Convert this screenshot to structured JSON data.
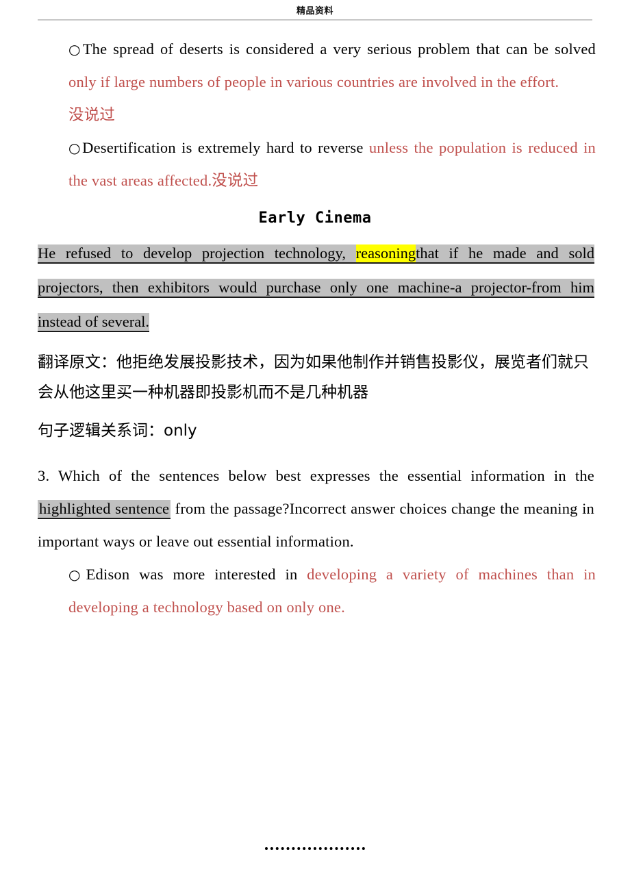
{
  "header": {
    "title": "精品资料"
  },
  "colors": {
    "red_text": "#c0504d",
    "gray_highlight": "#c0c0c0",
    "yellow_highlight": "#ffff00",
    "header_rule": "#c8c8c8"
  },
  "options_group_1": {
    "bullet_marker": "○",
    "option_a": {
      "black_part": "The spread of deserts is considered a very serious problem that can be solved ",
      "red_part": "only if large numbers of people in various countries are involved in the effort.",
      "note": "没说过"
    },
    "option_b": {
      "black_part": "Desertification is extremely hard to reverse ",
      "red_part": "unless the population is reduced in the vast areas affected.",
      "note": "没说过"
    }
  },
  "section": {
    "title": "Early Cinema"
  },
  "quote": {
    "gray_part_1": "He refused to develop projection technology, ",
    "yellow_part": "reasoning",
    "gray_part_2": "that if he made and sold projectors, then exhibitors would purchase only one machine-a projector-from him instead of several."
  },
  "translation": {
    "label_and_text": "翻译原文：他拒绝发展投影技术，因为如果他制作并销售投影仪，展览者们就只会从他这里买一种机器即投影机而不是几种机器",
    "logic_word_line": "句子逻辑关系词：only"
  },
  "question": {
    "part_1": "3. Which of the sentences below best expresses the essential information in the ",
    "highlighted_phrase": "highlighted sentence",
    "part_2": " from the passage?Incorrect answer choices change the meaning in important ways or leave out essential information."
  },
  "options_group_2": {
    "bullet_marker": "○",
    "option_a": {
      "black_part": "Edison was more interested in ",
      "red_part": "developing a variety of machines than in developing a technology based on only one."
    }
  }
}
